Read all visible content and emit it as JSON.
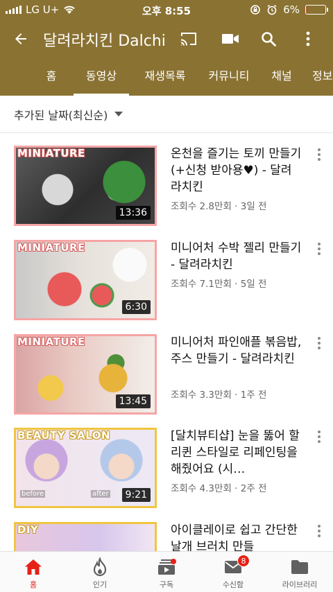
{
  "status_bar": {
    "carrier": "LG U+",
    "time": "오후 8:55",
    "battery_text": "6%",
    "battery_level": 0.06
  },
  "app_bar": {
    "title": "달려라치킨 Dalchi"
  },
  "tabs": [
    {
      "label": "홈"
    },
    {
      "label": "동영상",
      "active": true
    },
    {
      "label": "재생목록"
    },
    {
      "label": "커뮤니티"
    },
    {
      "label": "채널"
    },
    {
      "label": "정보"
    }
  ],
  "sort": {
    "label": "추가된 날짜(최신순)"
  },
  "videos": [
    {
      "tag": "MINIATURE",
      "duration": "13:36",
      "title": "온천을 즐기는 토끼 만들기 (+신청 받아용♥) - 달려라치킨",
      "meta": "조회수 2.8만회 · 3일 전"
    },
    {
      "tag": "MINIATURE",
      "duration": "6:30",
      "title": "미니어처 수박 젤리 만들기 - 달려라치킨",
      "meta": "조회수 7.1만회 · 5일 전"
    },
    {
      "tag": "MINIATURE",
      "duration": "13:45",
      "title": "미니어처 파인애플 볶음밥, 주스 만들기  - 달려라치킨",
      "meta": "조회수 3.3만회 · 1주 전"
    },
    {
      "tag": "BEAUTY SALON",
      "duration": "9:21",
      "title": "[달치뷰티샵] 눈을 뚫어 할리퀸 스타일로 리페인팅을 해줬어요 (시…",
      "meta": "조회수 4.3만회 · 2주 전",
      "before": "before",
      "after": "after"
    },
    {
      "tag": "DIY",
      "title": "아이클레이로 쉽고 간단한 날개 브러치 만들"
    }
  ],
  "bottom_nav": [
    {
      "label": "홈",
      "icon": "home-icon",
      "active": true
    },
    {
      "label": "인기",
      "icon": "trending-icon"
    },
    {
      "label": "구독",
      "icon": "subscriptions-icon"
    },
    {
      "label": "수신함",
      "icon": "inbox-icon",
      "badge": "8"
    },
    {
      "label": "라이브러리",
      "icon": "library-icon"
    }
  ],
  "colors": {
    "brand": "#8a7232",
    "accent": "#e62117"
  }
}
